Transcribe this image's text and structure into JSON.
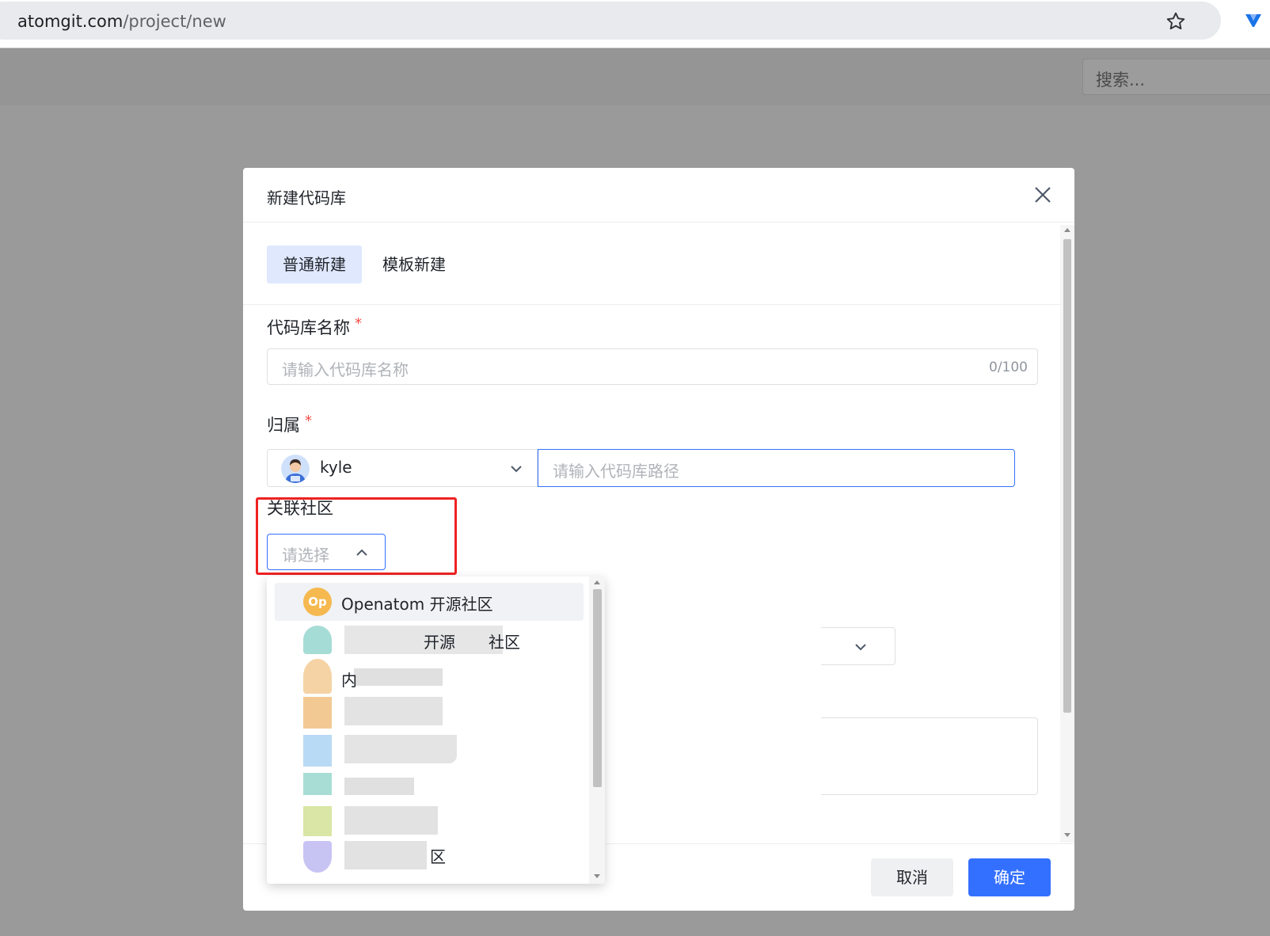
{
  "browser": {
    "url_host": "atomgit.com",
    "url_path": "/project/new"
  },
  "page": {
    "search_placeholder": "搜索..."
  },
  "modal": {
    "title": "新建代码库",
    "tabs": [
      {
        "label": "普通新建",
        "active": true
      },
      {
        "label": "模板新建",
        "active": false
      }
    ],
    "name_field": {
      "label": "代码库名称",
      "required_mark": "*",
      "placeholder": "请输入代码库名称",
      "counter": "0/100"
    },
    "owner_field": {
      "label": "归属",
      "required_mark": "*",
      "owner": "kyle",
      "path_placeholder": "请输入代码库路径"
    },
    "community_field": {
      "label": "关联社区",
      "placeholder": "请选择"
    },
    "cancel_label": "取消",
    "ok_label": "确定"
  },
  "dropdown": {
    "options": [
      {
        "avatar": "Op",
        "label": "Openatom 开源社区",
        "avatar_color": "#f5b94f"
      },
      {
        "label": "开源",
        "suffix": "社区"
      },
      {
        "label": "内"
      },
      {
        "label": ""
      },
      {
        "label": ""
      },
      {
        "label": ""
      },
      {
        "label": ""
      },
      {
        "label": "",
        "suffix": "区"
      }
    ]
  },
  "colors": {
    "primary": "#3370ff",
    "required": "#f54a45",
    "highlight": "#ee2222",
    "tab_active_bg": "#dfe8fd"
  }
}
